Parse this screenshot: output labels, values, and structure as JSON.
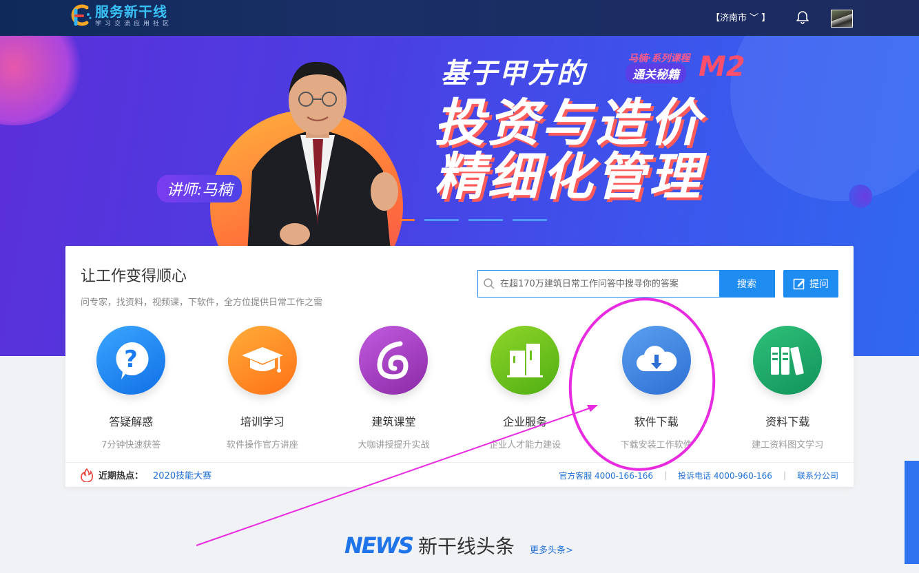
{
  "header": {
    "logo_title": "服务新干线",
    "logo_subtitle": "学习交流应用社区",
    "city": "【济南市 ﹀ 】"
  },
  "banner": {
    "lecturer": "讲师:马楠",
    "headline_1": "基于甲方的",
    "series_tag": "马楠·系列课程",
    "series_pill": "通关秘籍",
    "series_code": "M2",
    "headline_2": "投资与造价",
    "headline_3": "精细化管理"
  },
  "panel": {
    "title": "让工作变得顺心",
    "subtitle": "问专家，找资料，视频课，下软件，全方位提供日常工作之需",
    "search": {
      "placeholder": "在超170万建筑日常工作问答中搜寻你的答案",
      "button": "搜索"
    },
    "ask_button": "提问",
    "services": [
      {
        "name": "答疑解惑",
        "desc": "7分钟快速获答",
        "icon": "question-bubble-icon",
        "color": "#1e8cf0"
      },
      {
        "name": "培训学习",
        "desc": "软件操作官方讲座",
        "icon": "graduation-cap-icon",
        "color": "#ff8a1e"
      },
      {
        "name": "建筑课堂",
        "desc": "大咖讲授提升实战",
        "icon": "swirl-icon",
        "color": "#a23fc4"
      },
      {
        "name": "企业服务",
        "desc": "企业人才能力建设",
        "icon": "buildings-icon",
        "color": "#6cc11a"
      },
      {
        "name": "软件下载",
        "desc": "下载安装工作软件",
        "icon": "cloud-download-icon",
        "color": "#3e86e0"
      },
      {
        "name": "资料下载",
        "desc": "建工资料图文学习",
        "icon": "binders-icon",
        "color": "#1ea567"
      }
    ],
    "footer": {
      "hot_label": "近期热点：",
      "hot_link": "2020技能大赛",
      "service_phone": "官方客服 4000-166-166",
      "complaint_phone": "投诉电话 4000-960-166",
      "branch_link": "联系分公司"
    }
  },
  "news": {
    "en": "NEWS",
    "cn": "新干线头条",
    "more": "更多头条>"
  },
  "colors": {
    "accent": "#1e8cf0",
    "annotation": "#e82be0"
  }
}
